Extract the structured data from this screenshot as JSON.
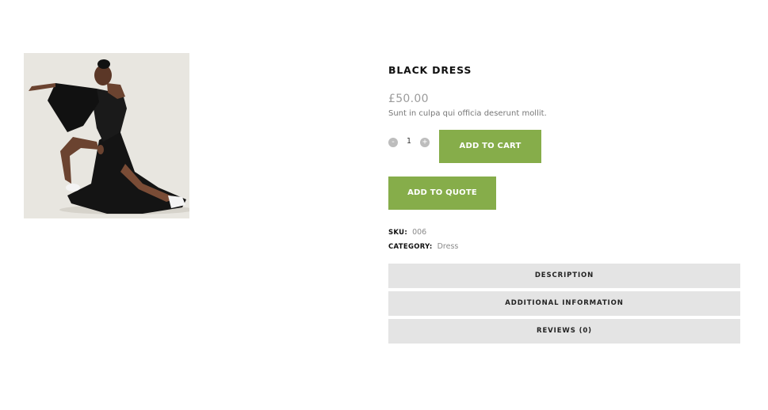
{
  "product": {
    "title": "BLACK DRESS",
    "price": "£50.00",
    "short_description": "Sunt in culpa qui officia deserunt mollit.",
    "image_icon": "photo-of-model-in-black-dress"
  },
  "quantity": {
    "minus_label": "-",
    "value": "1",
    "plus_label": "+"
  },
  "buttons": {
    "add_to_cart": "ADD TO CART",
    "add_to_quote": "ADD TO QUOTE"
  },
  "meta": {
    "sku_label": "SKU:",
    "sku_value": "006",
    "category_label": "CATEGORY:",
    "category_value": "Dress"
  },
  "tabs": [
    {
      "label": "DESCRIPTION"
    },
    {
      "label": "ADDITIONAL INFORMATION"
    },
    {
      "label": "REVIEWS (0)"
    }
  ],
  "colors": {
    "accent_green": "#86ad4a",
    "tab_background": "#e4e4e4",
    "price_grey": "#9b9b9b"
  }
}
